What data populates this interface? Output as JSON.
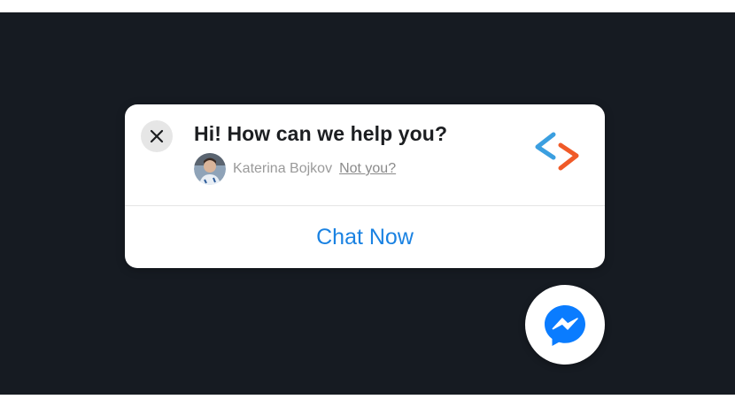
{
  "popup": {
    "title": "Hi! How can we help you?",
    "user_name": "Katerina Bojkov",
    "not_you_label": "Not you?",
    "chat_now_label": "Chat Now",
    "icons": {
      "close": "close-icon",
      "avatar": "avatar",
      "brand_logo": "code-brackets-logo",
      "messenger": "messenger-icon"
    }
  },
  "colors": {
    "background": "#161b22",
    "card": "#ffffff",
    "chat_now_text": "#1a82e2",
    "brand_blue": "#3b9fe0",
    "brand_orange": "#f05a28",
    "messenger_blue": "#0a7cff"
  }
}
